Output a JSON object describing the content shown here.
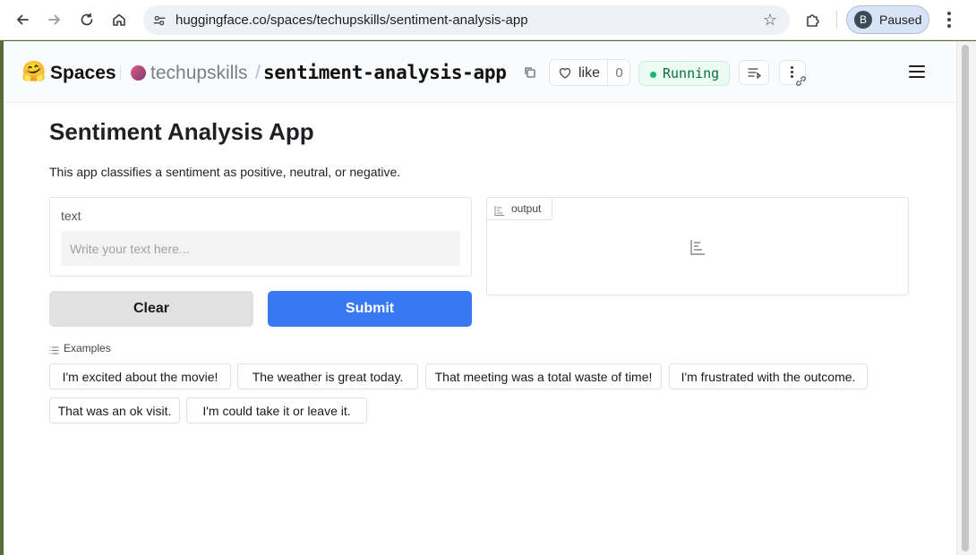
{
  "browser": {
    "url": "huggingface.co/spaces/techupskills/sentiment-analysis-app",
    "profile_initial": "B",
    "profile_status": "Paused"
  },
  "header": {
    "brand": "Spaces",
    "owner": "techupskills",
    "separator": "/",
    "repo": "sentiment-analysis-app",
    "like_label": "like",
    "like_count": "0",
    "status": "Running",
    "status_color": "#10b96b"
  },
  "app": {
    "title": "Sentiment Analysis App",
    "description": "This app classifies a sentiment as positive, neutral, or negative.",
    "input_label": "text",
    "input_placeholder": "Write your text here...",
    "input_value": "",
    "output_label": "output",
    "clear_label": "Clear",
    "submit_label": "Submit",
    "submit_color": "#3878f0",
    "examples_label": "Examples",
    "examples": [
      "I'm excited about the movie!",
      "The weather is great today.",
      "That meeting was a total waste of time!",
      "I'm frustrated with the outcome.",
      "That was an ok visit.",
      "I'm could take it or leave it."
    ]
  }
}
